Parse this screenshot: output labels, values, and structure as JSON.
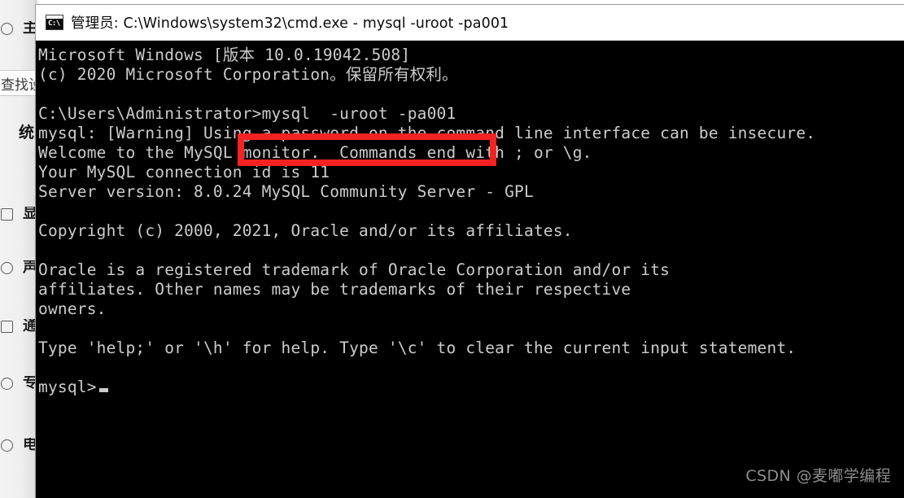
{
  "background_panel": {
    "search_box": {
      "text": "查找设置",
      "placeholder": "查找设置"
    },
    "heading": "统",
    "items": [
      {
        "icon": "circle-icon",
        "label": "主页"
      },
      {
        "icon": "display-icon",
        "label": "显示"
      },
      {
        "icon": "sound-icon",
        "label": "声音"
      },
      {
        "icon": "notification-icon",
        "label": "通知和操作"
      },
      {
        "icon": "focus-assist-icon",
        "label": "专注助手"
      },
      {
        "icon": "power-icon",
        "label": "电源和睡眠"
      }
    ]
  },
  "window": {
    "icon": "cmd-icon",
    "icon_glyph": "C:\\",
    "title": "管理员: C:\\Windows\\system32\\cmd.exe - mysql  -uroot -pa001"
  },
  "terminal": {
    "background_color": "#000000",
    "text_color": "#cccccc",
    "lines": [
      "Microsoft Windows [版本 10.0.19042.508]",
      "(c) 2020 Microsoft Corporation。保留所有权利。",
      "",
      "C:\\Users\\Administrator>mysql  -uroot -pa001",
      "mysql: [Warning] Using a password on the command line interface can be insecure.",
      "Welcome to the MySQL monitor.  Commands end with ; or \\g.",
      "Your MySQL connection id is 11",
      "Server version: 8.0.24 MySQL Community Server - GPL",
      "",
      "Copyright (c) 2000, 2021, Oracle and/or its affiliates.",
      "",
      "Oracle is a registered trademark of Oracle Corporation and/or its",
      "affiliates. Other names may be trademarks of their respective",
      "owners.",
      "",
      "Type 'help;' or '\\h' for help. Type '\\c' to clear the current input statement.",
      "",
      "mysql>"
    ],
    "prompt": "mysql>",
    "cursor": "block-cursor"
  },
  "annotation": {
    "type": "red-rectangle",
    "color": "#f52222",
    "highlights": "mysql  -uroot -pa001"
  },
  "watermark": {
    "text": "CSDN @麦嘟学编程"
  }
}
